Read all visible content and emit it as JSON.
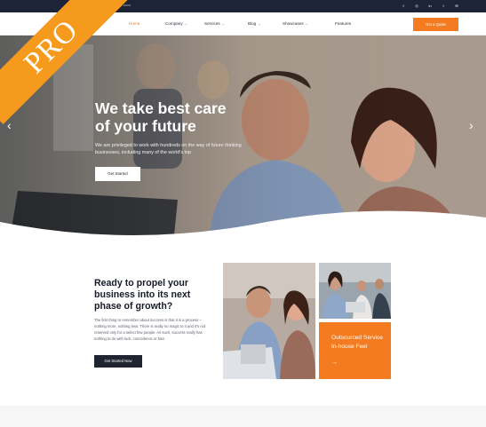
{
  "topbar": {
    "email": "info@yoursite.com",
    "social_icons": [
      "facebook-icon",
      "instagram-icon",
      "linkedin-icon",
      "twitter-icon",
      "mail-icon"
    ]
  },
  "nav": {
    "items": [
      {
        "label": "Home",
        "active": true,
        "dropdown": false
      },
      {
        "label": "Company",
        "active": false,
        "dropdown": true
      },
      {
        "label": "Services",
        "active": false,
        "dropdown": true
      },
      {
        "label": "Blog",
        "active": false,
        "dropdown": true
      },
      {
        "label": "Showcases",
        "active": false,
        "dropdown": true
      },
      {
        "label": "Features",
        "active": false,
        "dropdown": false
      }
    ],
    "cta_label": "Get a Quote"
  },
  "hero": {
    "title_line1": "We take  best care",
    "title_line2": "of your future",
    "subtitle": "We are privileged to work with hundreds on the  way  of  future thinking businesses, including many of the world's top",
    "button_label": "Get Started",
    "arrow_left": "‹",
    "arrow_right": "›"
  },
  "about": {
    "title": "Ready to propel your business into its next phase of growth?",
    "text": "The first thing to remember about success is that it is a process – nothing more, nothing less. There is really no magic to it and it's not reserved only for a select few people. As such, success really has nothing to do with luck, coincidence or fate.",
    "button_label": "Get Started Now"
  },
  "card": {
    "title": "Outsourced Service In-house Feel",
    "arrow": "→"
  },
  "ribbon": {
    "label": "PRO"
  },
  "colors": {
    "accent": "#f47b20",
    "dark": "#1e2437",
    "ribbon": "#f59a1c"
  }
}
